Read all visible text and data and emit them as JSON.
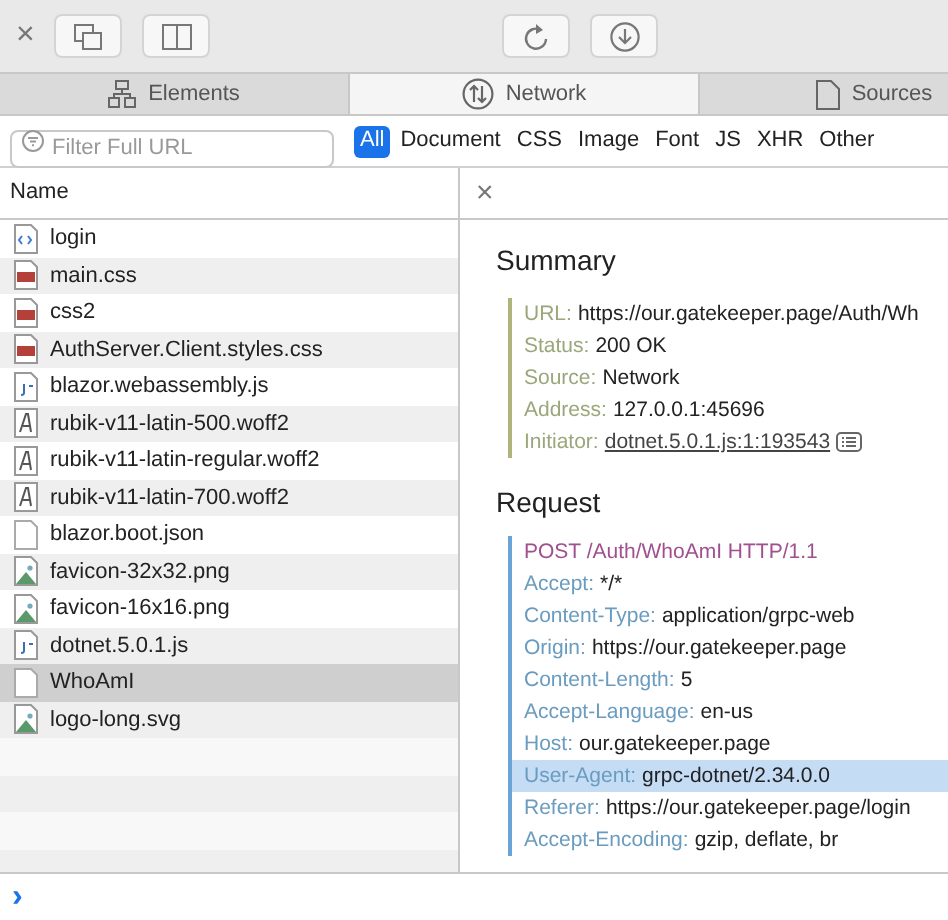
{
  "toolbar": {
    "close": "×"
  },
  "tabs": [
    {
      "label": "Elements",
      "selected": false
    },
    {
      "label": "Network",
      "selected": true
    },
    {
      "label": "Sources",
      "selected": false
    }
  ],
  "filter": {
    "placeholder": "Filter Full URL"
  },
  "types": [
    {
      "label": "All",
      "selected": true
    },
    {
      "label": "Document",
      "selected": false
    },
    {
      "label": "CSS",
      "selected": false
    },
    {
      "label": "Image",
      "selected": false
    },
    {
      "label": "Font",
      "selected": false
    },
    {
      "label": "JS",
      "selected": false
    },
    {
      "label": "XHR",
      "selected": false
    },
    {
      "label": "Other",
      "selected": false
    }
  ],
  "list": {
    "header": "Name",
    "rows": [
      {
        "name": "login",
        "kind": "html",
        "selected": false
      },
      {
        "name": "main.css",
        "kind": "css",
        "selected": false
      },
      {
        "name": "css2",
        "kind": "css",
        "selected": false
      },
      {
        "name": "AuthServer.Client.styles.css",
        "kind": "css",
        "selected": false
      },
      {
        "name": "blazor.webassembly.js",
        "kind": "js",
        "selected": false
      },
      {
        "name": "rubik-v11-latin-500.woff2",
        "kind": "font",
        "selected": false
      },
      {
        "name": "rubik-v11-latin-regular.woff2",
        "kind": "font",
        "selected": false
      },
      {
        "name": "rubik-v11-latin-700.woff2",
        "kind": "font",
        "selected": false
      },
      {
        "name": "blazor.boot.json",
        "kind": "file",
        "selected": false
      },
      {
        "name": "favicon-32x32.png",
        "kind": "image",
        "selected": false
      },
      {
        "name": "favicon-16x16.png",
        "kind": "image",
        "selected": false
      },
      {
        "name": "dotnet.5.0.1.js",
        "kind": "js",
        "selected": false
      },
      {
        "name": "WhoAmI",
        "kind": "file",
        "selected": true
      },
      {
        "name": "logo-long.svg",
        "kind": "image",
        "selected": false
      }
    ]
  },
  "detail": {
    "close": "×",
    "summary": {
      "title": "Summary",
      "fields": [
        {
          "label": "URL:",
          "value": "https://our.gatekeeper.page/Auth/Wh"
        },
        {
          "label": "Status:",
          "value": "200 OK"
        },
        {
          "label": "Source:",
          "value": "Network"
        },
        {
          "label": "Address:",
          "value": "127.0.0.1:45696"
        },
        {
          "label": "Initiator:",
          "link": "dotnet.5.0.1.js:1:193543"
        }
      ]
    },
    "request": {
      "title": "Request",
      "line": "POST /Auth/WhoAmI HTTP/1.1",
      "headers": [
        {
          "label": "Accept:",
          "value": "*/*",
          "highlighted": false
        },
        {
          "label": "Content-Type:",
          "value": "application/grpc-web",
          "highlighted": false
        },
        {
          "label": "Origin:",
          "value": "https://our.gatekeeper.page",
          "highlighted": false
        },
        {
          "label": "Content-Length:",
          "value": "5",
          "highlighted": false
        },
        {
          "label": "Accept-Language:",
          "value": "en-us",
          "highlighted": false
        },
        {
          "label": "Host:",
          "value": "our.gatekeeper.page",
          "highlighted": false
        },
        {
          "label": "User-Agent:",
          "value": "grpc-dotnet/2.34.0.0",
          "highlighted": true
        },
        {
          "label": "Referer:",
          "value": "https://our.gatekeeper.page/login",
          "highlighted": false
        },
        {
          "label": "Accept-Encoding:",
          "value": "gzip, deflate, br",
          "highlighted": false
        }
      ]
    }
  },
  "console": {
    "prompt": "›"
  }
}
